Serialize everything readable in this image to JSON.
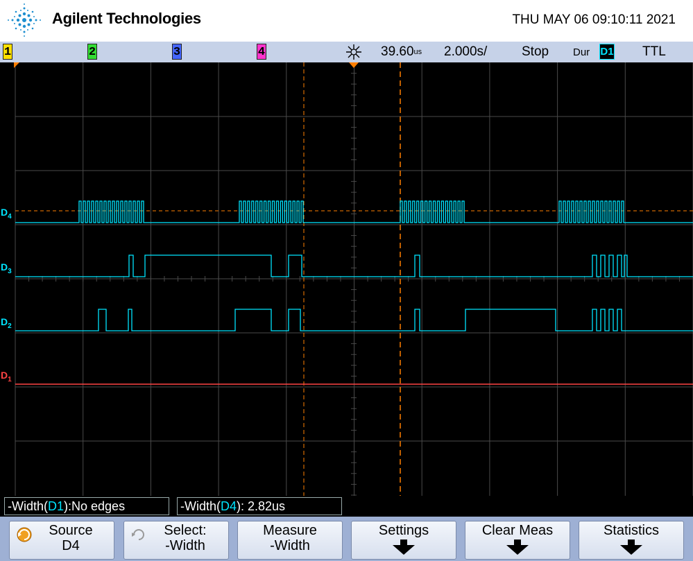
{
  "header": {
    "brand": "Agilent Technologies",
    "datetime": "THU MAY 06 09:10:11 2021"
  },
  "statusbar": {
    "channels": [
      {
        "label": "1",
        "color": "#ffe000"
      },
      {
        "label": "2",
        "color": "#33dd33"
      },
      {
        "label": "3",
        "color": "#4466ff"
      },
      {
        "label": "4",
        "color": "#ff33cc"
      }
    ],
    "delay_value": "39.60",
    "delay_unit": "us",
    "timebase_value": "2.000",
    "timebase_unit": "s/",
    "run_state": "Stop",
    "trigger_mode": "Dur",
    "trigger_source": "D1",
    "trigger_level": "TTL"
  },
  "lanes": [
    {
      "label": "D4",
      "color": "#00e5ff"
    },
    {
      "label": "D3",
      "color": "#00e5ff"
    },
    {
      "label": "D2",
      "color": "#00e5ff"
    },
    {
      "label": "D1",
      "color": "#ff4444"
    }
  ],
  "measurements": [
    {
      "prefix": "-Width(",
      "channel": "D1",
      "suffix": "):No edges"
    },
    {
      "prefix": "-Width(",
      "channel": "D4",
      "suffix": "): 2.82us"
    }
  ],
  "softkeys": [
    {
      "line1": "Source",
      "line2": "D4",
      "icon": "rotate-knob-icon"
    },
    {
      "line1": "Select:",
      "line2": "-Width",
      "icon": "rotate-knob-icon"
    },
    {
      "line1": "Measure",
      "line2": "-Width"
    },
    {
      "line1": "Settings",
      "icon": "arrow-down-icon"
    },
    {
      "line1": "Clear Meas",
      "icon": "arrow-down-icon"
    },
    {
      "line1": "Statistics",
      "icon": "arrow-down-icon"
    }
  ],
  "colors": {
    "trace": "#00e5ff",
    "d1_trace": "#ff4444",
    "cursor": "#ff7f00",
    "grid": "#4a4a4a"
  }
}
